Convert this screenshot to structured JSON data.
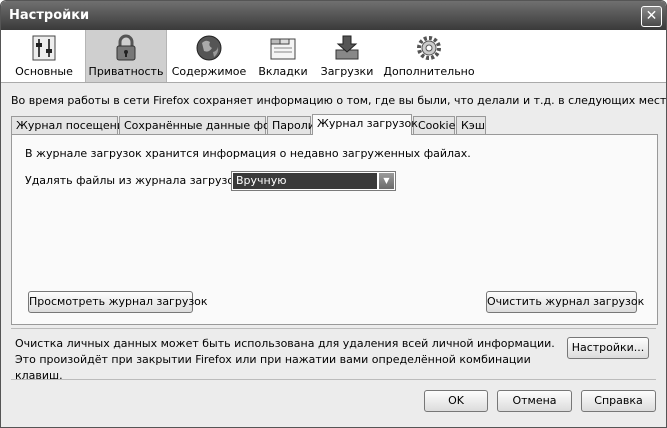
{
  "window": {
    "title": "Настройки"
  },
  "toolbar": {
    "items": [
      {
        "label": "Основные",
        "icon": "general-icon"
      },
      {
        "label": "Приватность",
        "icon": "lock-icon"
      },
      {
        "label": "Содержимое",
        "icon": "globe-icon"
      },
      {
        "label": "Вкладки",
        "icon": "tabs-icon"
      },
      {
        "label": "Загрузки",
        "icon": "downloads-icon"
      },
      {
        "label": "Дополнительно",
        "icon": "gear-icon"
      }
    ],
    "active_index": 1
  },
  "intro": "Во время работы в сети Firefox сохраняет информацию о том, где вы были, что делали и т.д. в следующих местах:",
  "tabs": [
    {
      "label": "Журнал посещений"
    },
    {
      "label": "Сохранённые данные форм"
    },
    {
      "label": "Пароли"
    },
    {
      "label": "Журнал загрузок"
    },
    {
      "label": "Cookies"
    },
    {
      "label": "Кэш"
    }
  ],
  "active_tab": 3,
  "panel": {
    "description": "В журнале загрузок хранится информация о недавно загруженных файлах.",
    "delete_label": "Удалять файлы из журнала загрузок:",
    "delete_value": "Вручную",
    "view_button": "Просмотреть журнал загрузок",
    "clear_button": "Очистить журнал загрузок"
  },
  "clear_private": {
    "text": "Очистка личных данных может быть использована для удаления всей личной информации. Это произойдёт при закрытии Firefox или при нажатии вами определённой комбинации клавиш.",
    "settings_button": "Настройки..."
  },
  "footer": {
    "ok": "OK",
    "cancel": "Отмена",
    "help": "Справка"
  }
}
